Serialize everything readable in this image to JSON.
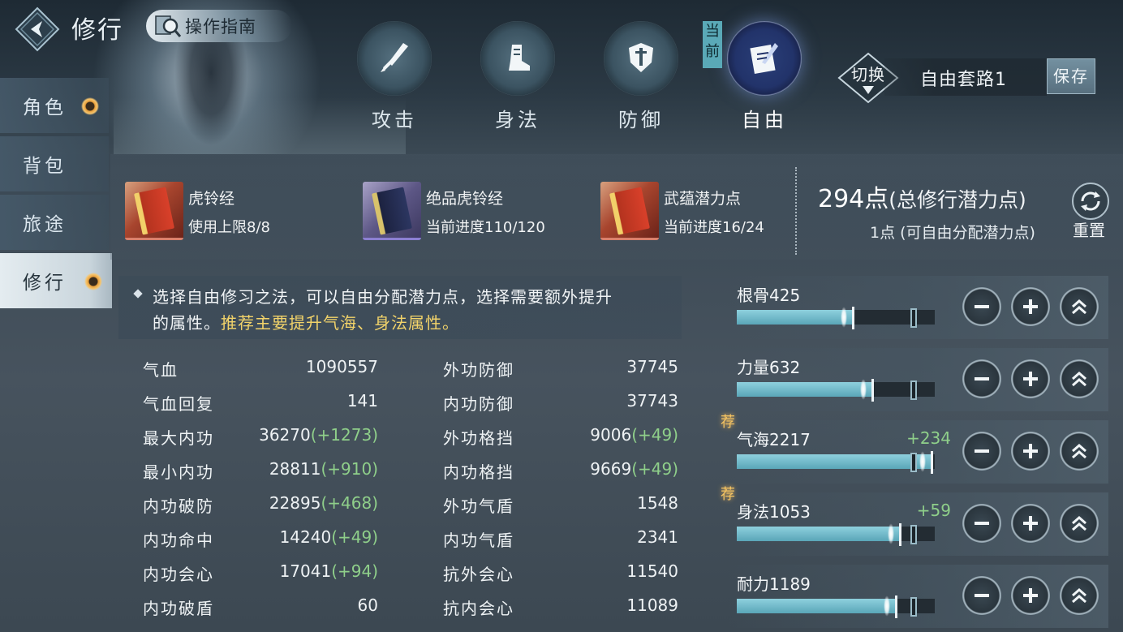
{
  "header": {
    "title": "修行",
    "guide_label": "操作指南"
  },
  "nav": [
    {
      "label": "角色",
      "badge": true
    },
    {
      "label": "背包",
      "badge": false
    },
    {
      "label": "旅途",
      "badge": false
    },
    {
      "label": "修行",
      "badge": true,
      "active": true
    }
  ],
  "tabs": [
    {
      "label": "攻击",
      "icon": "sword-icon"
    },
    {
      "label": "身法",
      "icon": "boot-icon"
    },
    {
      "label": "防御",
      "icon": "shield-icon"
    },
    {
      "label": "自由",
      "icon": "scroll-quill-icon",
      "active": true
    }
  ],
  "current_tag": "当前",
  "set_switch": {
    "switch_label": "切换",
    "set_name": "自由套路1",
    "save_label": "保存"
  },
  "items": [
    {
      "name": "虎铃经",
      "sub": "使用上限8/8",
      "rarity": "red"
    },
    {
      "name": "绝品虎铃经",
      "sub": "当前进度110/120",
      "rarity": "purple"
    },
    {
      "name": "武蕴潜力点",
      "sub": "当前进度16/24",
      "rarity": "red"
    }
  ],
  "points": {
    "total_value": "294点",
    "total_suffix": "(总修行潜力点)",
    "free": "1点 (可自由分配潜力点)",
    "reset_label": "重置"
  },
  "tip": {
    "line1": "选择自由修习之法，可以自由分配潜力点，选择需要额外提升",
    "line2_a": "的属性。",
    "line2_b": "推荐主要提升气海、身法属性。"
  },
  "stats_left": [
    {
      "name": "气血",
      "value": "1090557",
      "bonus": ""
    },
    {
      "name": "气血回复",
      "value": "141",
      "bonus": ""
    },
    {
      "name": "最大内功",
      "value": "36270",
      "bonus": "(+1273)"
    },
    {
      "name": "最小内功",
      "value": "28811",
      "bonus": "(+910)"
    },
    {
      "name": "内功破防",
      "value": "22895",
      "bonus": "(+468)"
    },
    {
      "name": "内功命中",
      "value": "14240",
      "bonus": "(+49)"
    },
    {
      "name": "内功会心",
      "value": "17041",
      "bonus": "(+94)"
    },
    {
      "name": "内功破盾",
      "value": "60",
      "bonus": ""
    }
  ],
  "stats_right": [
    {
      "name": "外功防御",
      "value": "37745",
      "bonus": ""
    },
    {
      "name": "内功防御",
      "value": "37743",
      "bonus": ""
    },
    {
      "name": "外功格挡",
      "value": "9006",
      "bonus": "(+49)"
    },
    {
      "name": "内功格挡",
      "value": "9669",
      "bonus": "(+49)"
    },
    {
      "name": "外功气盾",
      "value": "1548",
      "bonus": ""
    },
    {
      "name": "内功气盾",
      "value": "2341",
      "bonus": ""
    },
    {
      "name": "抗外会心",
      "value": "11540",
      "bonus": ""
    },
    {
      "name": "抗内会心",
      "value": "11089",
      "bonus": ""
    }
  ],
  "attributes": [
    {
      "name": "根骨425",
      "increase": "",
      "recommended": false,
      "fill": 0.58
    },
    {
      "name": "力量632",
      "increase": "",
      "recommended": false,
      "fill": 0.68
    },
    {
      "name": "气海2217",
      "increase": "+234",
      "recommended": true,
      "fill": 0.98,
      "rec_label": "荐"
    },
    {
      "name": "身法1053",
      "increase": "+59",
      "recommended": true,
      "fill": 0.82,
      "rec_label": "荐"
    },
    {
      "name": "耐力1189",
      "increase": "",
      "recommended": false,
      "fill": 0.8
    }
  ],
  "colors": {
    "accent_teal": "#5aa6b8",
    "bonus_green": "#8fcf8a",
    "highlight_yellow": "#f2d36a"
  }
}
